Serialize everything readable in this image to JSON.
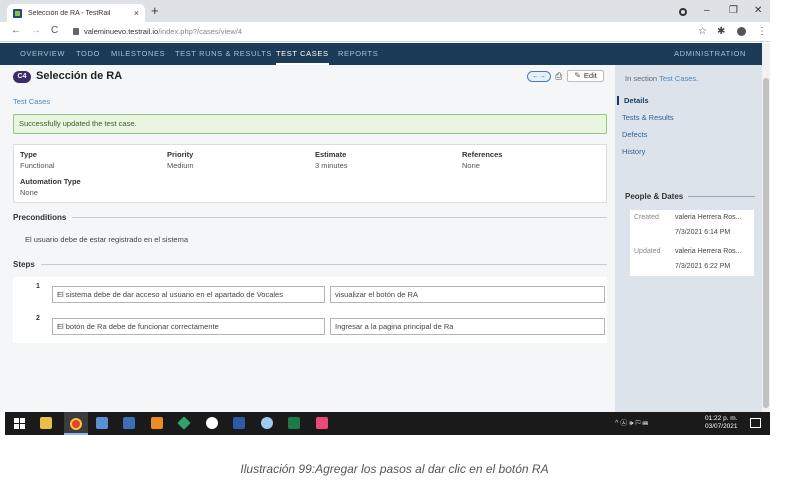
{
  "browser": {
    "tab_title": "Selección de RA - TestRail",
    "tab_close": "×",
    "new_tab": "+",
    "window_controls": [
      "–",
      "❐",
      "✕"
    ],
    "nav": {
      "back": "←",
      "forward": "→",
      "reload": "C"
    },
    "url_host": "valeminuevo.testrail.io",
    "url_path": "/index.php?/cases/view/4",
    "right_icons": [
      "☆",
      "✱",
      "⋮"
    ]
  },
  "appnav": {
    "items": [
      "OVERVIEW",
      "TODO",
      "MILESTONES",
      "TEST RUNS & RESULTS",
      "TEST CASES",
      "REPORTS"
    ],
    "active": "TEST CASES",
    "admin": "ADMINISTRATION"
  },
  "case": {
    "id": "C4",
    "title": "Selección de RA",
    "nav_arrows": "←→",
    "print_icon": "⎙",
    "edit_label": "Edit",
    "breadcrumb": "Test Cases",
    "alert": "Successfully updated the test case.",
    "fields": [
      {
        "label": "Type",
        "value": "Functional"
      },
      {
        "label": "Priority",
        "value": "Medium"
      },
      {
        "label": "Estimate",
        "value": "3 minutes"
      },
      {
        "label": "References",
        "value": "None"
      },
      {
        "label": "Automation Type",
        "value": "None"
      }
    ],
    "preconditions_label": "Preconditions",
    "preconditions_text": "El usuario debe de estar registrado en el sistema",
    "steps_label": "Steps",
    "steps": [
      {
        "num": "1",
        "content": "El sistema debe de dar acceso al usuario en el apartado de Vocales",
        "expected": "visualizar el botón de RA"
      },
      {
        "num": "2",
        "content": "El botón de Ra debe de funcionar correctamente",
        "expected": "Ingresar a la pagina principal de Ra"
      }
    ]
  },
  "sidebar": {
    "in_section_prefix": "In section",
    "in_section_link": "Test Cases",
    "in_section_suffix": ".",
    "tabs": [
      "Details",
      "Tests & Results",
      "Defects",
      "History"
    ],
    "active_tab": "Details",
    "people_title": "People & Dates",
    "created_label": "Created",
    "created_by": "valeria Herrera Ros...",
    "created_at": "7/3/2021 6:14 PM",
    "updated_label": "Updated",
    "updated_by": "valeria Herrera Ros...",
    "updated_at": "7/3/2021 6:22 PM"
  },
  "taskbar": {
    "time": "01:22 p. m.",
    "date": "03/07/2021",
    "tray": "^  ㉦  🕪  ⚐  ⌨"
  },
  "caption": "Ilustración 99:Agregar los pasos al dar clic en el botón RA",
  "colors": {
    "nav_bg": "#1b3b57",
    "case_badge": "#3b2b6b",
    "alert_bg": "#eaf5e1",
    "alert_border": "#93c77b",
    "link": "#4a86c8",
    "sidebar_bg": "#dde3ea"
  }
}
